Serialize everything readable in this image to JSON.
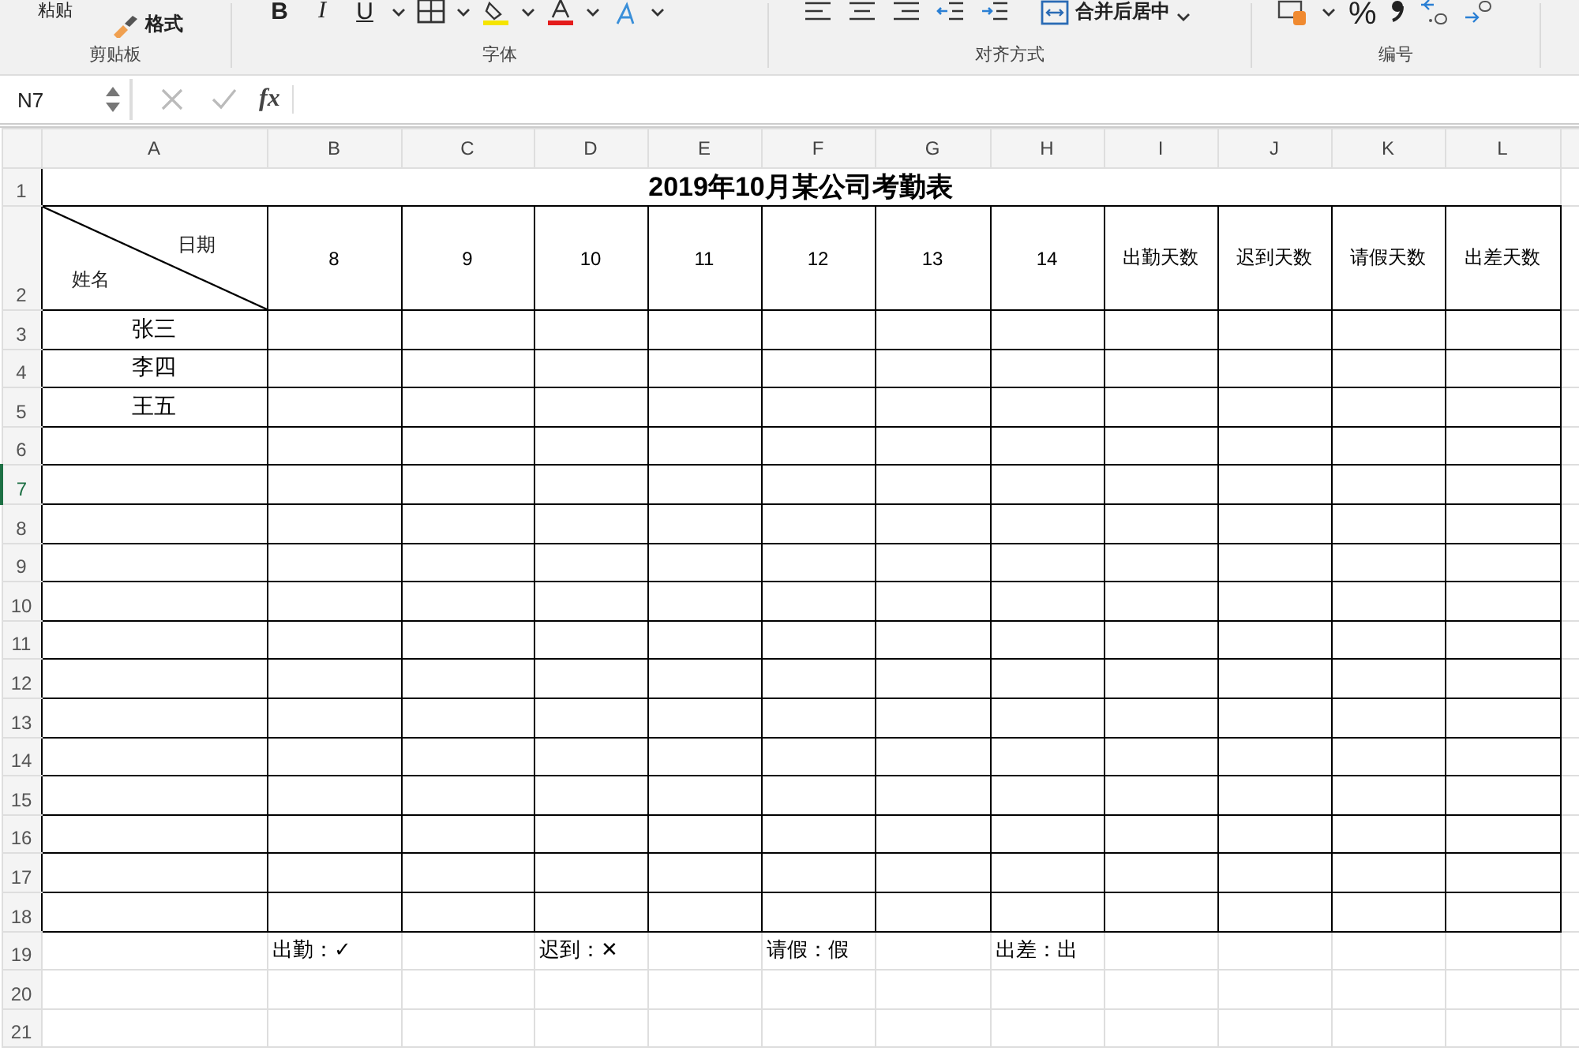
{
  "ribbon": {
    "groups": [
      {
        "kind": "clipboard",
        "label": "剪贴板",
        "paste": "粘贴",
        "format_painter": "格式"
      },
      {
        "kind": "font",
        "label": "字体",
        "styles": [
          "B",
          "I",
          "U"
        ]
      },
      {
        "kind": "alignment",
        "label": "对齐方式",
        "merge": "合并后居中"
      },
      {
        "kind": "number",
        "label": "编号",
        "percent": "%"
      }
    ]
  },
  "formula_bar": {
    "name_box": "N7",
    "function_label": "fx"
  },
  "sheet": {
    "columns": [
      "A",
      "B",
      "C",
      "D",
      "E",
      "F",
      "G",
      "H",
      "I",
      "J",
      "K",
      "L"
    ],
    "rows": [
      {
        "label": "1",
        "selected": false
      },
      {
        "label": "2",
        "selected": false
      },
      {
        "label": "3",
        "selected": false
      },
      {
        "label": "4",
        "selected": false
      },
      {
        "label": "5",
        "selected": false
      },
      {
        "label": "6",
        "selected": false
      },
      {
        "label": "7",
        "selected": true
      },
      {
        "label": "8",
        "selected": false
      },
      {
        "label": "9",
        "selected": false
      },
      {
        "label": "10",
        "selected": false
      },
      {
        "label": "11",
        "selected": false
      },
      {
        "label": "12",
        "selected": false
      },
      {
        "label": "13",
        "selected": false
      },
      {
        "label": "14",
        "selected": false
      },
      {
        "label": "15",
        "selected": false
      },
      {
        "label": "16",
        "selected": false
      },
      {
        "label": "17",
        "selected": false
      },
      {
        "label": "18",
        "selected": false
      },
      {
        "label": "19",
        "selected": false
      },
      {
        "label": "20",
        "selected": false
      },
      {
        "label": "21",
        "selected": false
      }
    ],
    "title": "2019年10月某公司考勤表",
    "corner": {
      "top": "日期",
      "bottom": "姓名"
    },
    "headers": [
      "8",
      "9",
      "10",
      "11",
      "12",
      "13",
      "14",
      "出勤天数",
      "迟到天数",
      "请假天数",
      "出差天数"
    ],
    "names": [
      "张三",
      "李四",
      "王五"
    ],
    "legend": [
      "出勤：✓",
      "迟到：✕",
      "请假：假",
      "出差：出"
    ]
  }
}
